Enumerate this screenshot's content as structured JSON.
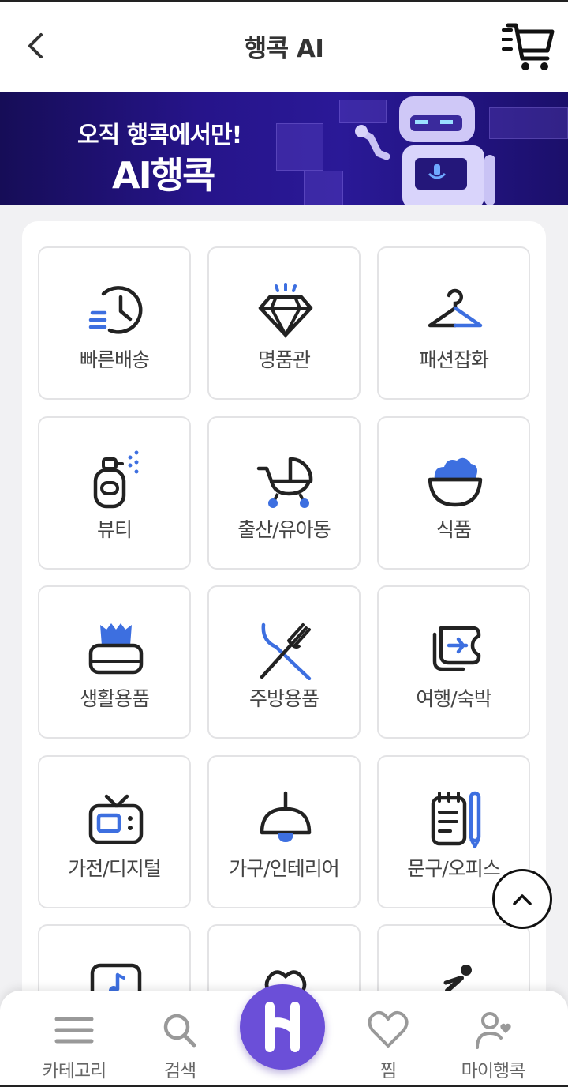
{
  "header": {
    "title": "행콕 AI"
  },
  "banner": {
    "subtitle": "오직 행콕에서만!",
    "title": "AI행콕"
  },
  "categories": [
    {
      "label": "빠른배송",
      "icon": "fast-delivery-icon"
    },
    {
      "label": "명품관",
      "icon": "diamond-icon"
    },
    {
      "label": "패션잡화",
      "icon": "hanger-icon"
    },
    {
      "label": "뷰티",
      "icon": "perfume-icon"
    },
    {
      "label": "출산/유아동",
      "icon": "stroller-icon"
    },
    {
      "label": "식품",
      "icon": "food-bowl-icon"
    },
    {
      "label": "생활용품",
      "icon": "tissue-box-icon"
    },
    {
      "label": "주방용품",
      "icon": "fork-knife-icon"
    },
    {
      "label": "여행/숙박",
      "icon": "travel-ticket-icon"
    },
    {
      "label": "가전/디지털",
      "icon": "tv-icon"
    },
    {
      "label": "가구/인테리어",
      "icon": "lamp-icon"
    },
    {
      "label": "문구/오피스",
      "icon": "notepad-icon"
    },
    {
      "label": "",
      "icon": "music-icon"
    },
    {
      "label": "",
      "icon": "pet-icon"
    },
    {
      "label": "",
      "icon": "sports-icon"
    }
  ],
  "bottom_nav": [
    {
      "label": "카테고리",
      "icon": "menu-icon"
    },
    {
      "label": "검색",
      "icon": "search-icon"
    },
    {
      "label": "",
      "icon": "home-logo-icon"
    },
    {
      "label": "찜",
      "icon": "heart-icon"
    },
    {
      "label": "마이행콕",
      "icon": "my-profile-icon"
    }
  ],
  "colors": {
    "accent": "#6b4fd8",
    "icon_blue": "#3d6fe0",
    "icon_dark": "#222222",
    "banner": "#26148a"
  }
}
